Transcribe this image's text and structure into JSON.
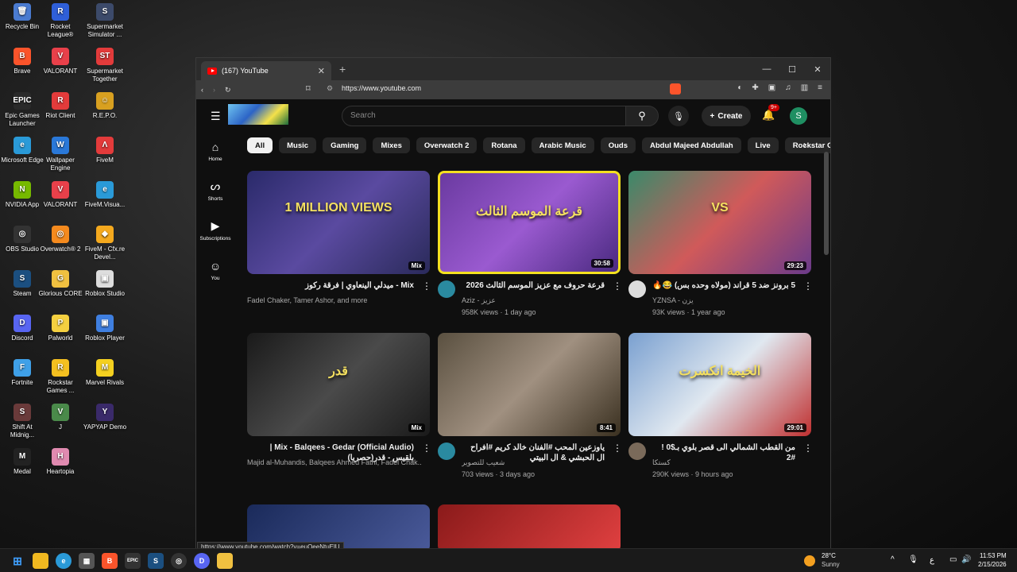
{
  "desktop": {
    "icons": [
      {
        "label": "Recycle Bin",
        "color": "#4a7bd0",
        "glyph": "🗑"
      },
      {
        "label": "Rocket League®",
        "color": "#2f5fd8",
        "glyph": "R"
      },
      {
        "label": "Supermarket Simulator ...",
        "color": "#3c4a6a",
        "glyph": "S"
      },
      {
        "label": "Brave",
        "color": "#fb542b",
        "glyph": "B"
      },
      {
        "label": "VALORANT",
        "color": "#e8404a",
        "glyph": "V"
      },
      {
        "label": "Supermarket Together",
        "color": "#e33b3b",
        "glyph": "ST"
      },
      {
        "label": "Epic Games Launcher",
        "color": "#2a2a2a",
        "glyph": "EPIC"
      },
      {
        "label": "Riot Client",
        "color": "#e33b3b",
        "glyph": "R"
      },
      {
        "label": "R.E.P.O.",
        "color": "#d8a020",
        "glyph": "☺"
      },
      {
        "label": "Microsoft Edge",
        "color": "#2a9ad8",
        "glyph": "e"
      },
      {
        "label": "Wallpaper Engine",
        "color": "#2a78d8",
        "glyph": "W"
      },
      {
        "label": "FiveM",
        "color": "#e33b3b",
        "glyph": "Λ"
      },
      {
        "label": "NVIDIA App",
        "color": "#76b900",
        "glyph": "N"
      },
      {
        "label": "VALORANT",
        "color": "#e8404a",
        "glyph": "V"
      },
      {
        "label": "FiveM.Visua...",
        "color": "#2a9ad8",
        "glyph": "e"
      },
      {
        "label": "OBS Studio",
        "color": "#333",
        "glyph": "◎"
      },
      {
        "label": "Overwatch® 2",
        "color": "#f48a1e",
        "glyph": "◎"
      },
      {
        "label": "FiveM - Cfx.re Devel...",
        "color": "#f4a91e",
        "glyph": "◆"
      },
      {
        "label": "Steam",
        "color": "#1b4f80",
        "glyph": "S"
      },
      {
        "label": "Glorious CORE",
        "color": "#f0c040",
        "glyph": "G"
      },
      {
        "label": "Roblox Studio",
        "color": "#ddd",
        "glyph": "▣"
      },
      {
        "label": "Discord",
        "color": "#5865f2",
        "glyph": "D"
      },
      {
        "label": "Palworld",
        "color": "#f4d040",
        "glyph": "P"
      },
      {
        "label": "Roblox Player",
        "color": "#3f7fe0",
        "glyph": "▣"
      },
      {
        "label": "Fortnite",
        "color": "#3fa0e8",
        "glyph": "F"
      },
      {
        "label": "Rockstar Games ...",
        "color": "#f4c020",
        "glyph": "R"
      },
      {
        "label": "Marvel Rivals",
        "color": "#f4d020",
        "glyph": "M"
      },
      {
        "label": "Shift At Midnig...",
        "color": "#6a3a3a",
        "glyph": "S"
      },
      {
        "label": "J",
        "color": "#4a8a4a",
        "glyph": "V"
      },
      {
        "label": "YAPYAP Demo",
        "color": "#3a2a6a",
        "glyph": "Y"
      },
      {
        "label": "Medal",
        "color": "#222",
        "glyph": "M"
      },
      {
        "label": "Heartopia",
        "color": "#e08ab0",
        "glyph": "H"
      }
    ]
  },
  "browser": {
    "tab_title": "(167) YouTube",
    "url": "https://www.youtube.com",
    "status_url": "https://www.youtube.com/watch?v=euQeeNtuElU"
  },
  "youtube": {
    "search_placeholder": "Search",
    "create_label": "Create",
    "notif_count": "9+",
    "avatar_letter": "S",
    "nav": [
      {
        "label": "Home",
        "icon": "⌂"
      },
      {
        "label": "Shorts",
        "icon": "ᔕ"
      },
      {
        "label": "Subscriptions",
        "icon": "▶"
      },
      {
        "label": "You",
        "icon": "☺"
      }
    ],
    "chips": [
      "All",
      "Music",
      "Gaming",
      "Mixes",
      "Overwatch 2",
      "Rotana",
      "Arabic Music",
      "Ouds",
      "Abdul Majeed Abdullah",
      "Live",
      "Rockstar Games"
    ],
    "videos": [
      {
        "title": "Mix - ميدلي الينعاوي | فرقة ركوز",
        "channel": "Fadel Chaker, Tamer Ashor, and more",
        "stats": "",
        "badge": "Mix",
        "thumb": "linear-gradient(135deg,#2a2a6a,#5a4aa0 50%,#2a2a5a)",
        "thumb_text": "1 MILLION VIEWS"
      },
      {
        "title": "قرعة حروف مع عزيز الموسم الثالث 2026",
        "channel": "Aziz - عزيز",
        "stats": "958K views · 1 day ago",
        "badge": "30:58",
        "thumb": "linear-gradient(135deg,#6a3aa0,#9a5ad0 50%,#4a2a80)",
        "thumb_text": "قرعة الموسم الثالث"
      },
      {
        "title": "5 برونز ضد 5 قراند (مولاه وحده بس) 😂🔥",
        "channel": "YZNSA - يزن",
        "stats": "93K views · 1 year ago",
        "badge": "29:23",
        "thumb": "linear-gradient(135deg,#3a8a6a,#d05a5a 50%,#6a3a8a)",
        "thumb_text": "VS"
      },
      {
        "title": "Mix - Balqees - Gedar (Official Audio) | بلقيس - قدر(حصريا)",
        "channel": "Majid al-Muhandis, Balqees Ahmed Fathi, Fadel Chak...",
        "stats": "",
        "badge": "Mix",
        "thumb": "linear-gradient(135deg,#1a1a1a,#4a4a4a 50%,#1a1a1a)",
        "thumb_text": "قدر"
      },
      {
        "title": "ياوزعين المحب #الفنان خالد كريم #افراح ال الحبشي & ال البيتي",
        "channel": "شعيب للتصوير",
        "stats": "703 views · 3 days ago",
        "badge": "8:41",
        "thumb": "linear-gradient(135deg,#5a5040,#a09080 50%,#3a3020)",
        "thumb_text": ""
      },
      {
        "title": "من القطب الشمالي الى قصر بلوي بـ$0 ! #2",
        "channel": "كستكا",
        "stats": "290K views · 9 hours ago",
        "badge": "29:01",
        "thumb": "linear-gradient(135deg,#7aa0d0,#e0e8f0 50%,#c03030)",
        "thumb_text": "الخيمة انكسرت"
      }
    ]
  },
  "taskbar": {
    "weather_temp": "28°C",
    "weather_desc": "Sunny",
    "time": "11:53 PM",
    "date": "2/15/2026",
    "lang": "ع"
  }
}
